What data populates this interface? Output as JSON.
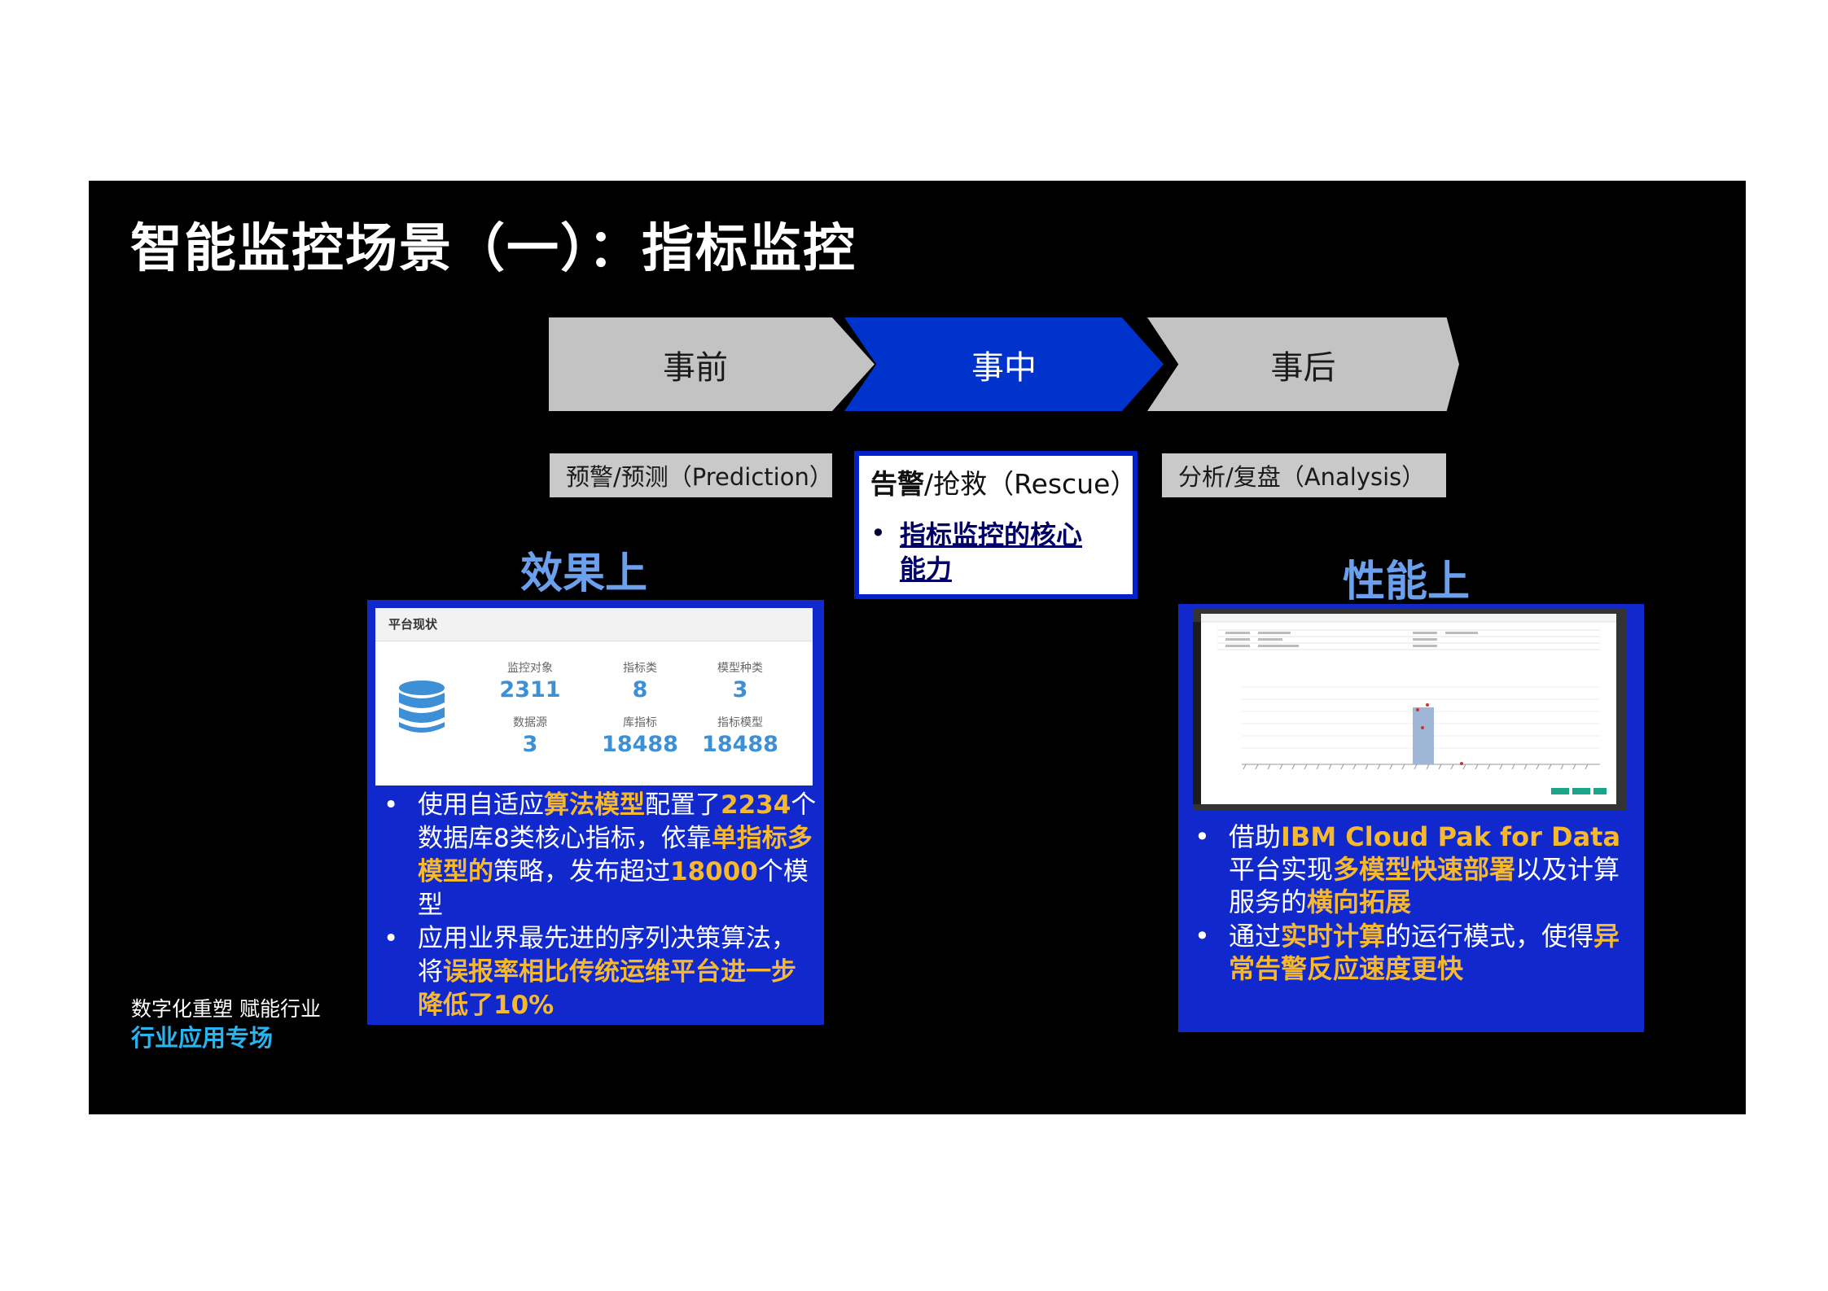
{
  "slide": {
    "title": "智能监控场景（一）：指标监控"
  },
  "process": {
    "stages": [
      {
        "label": "事前"
      },
      {
        "label": "事中"
      },
      {
        "label": "事后"
      }
    ],
    "active_color": "#0033cc",
    "inactive_color": "#c3c3c3"
  },
  "phases": {
    "prediction": "预警/预测（Prediction）",
    "rescue": {
      "title_bold": "告警",
      "title_rest": "/抢救（Rescue）",
      "bullet": "指标监控的核心能力"
    },
    "analysis": "分析/复盘（Analysis）"
  },
  "effect": {
    "heading": "效果上",
    "card": {
      "title": "平台现状",
      "stats": [
        {
          "label": "监控对象",
          "value": "2311"
        },
        {
          "label": "指标类",
          "value": "8"
        },
        {
          "label": "模型种类",
          "value": "3"
        },
        {
          "label": "数据源",
          "value": "3"
        },
        {
          "label": "库指标",
          "value": "18488"
        },
        {
          "label": "指标模型",
          "value": "18488"
        }
      ]
    },
    "bullets": [
      {
        "parts": [
          {
            "t": "使用自适应",
            "hl": false
          },
          {
            "t": "算法模型",
            "hl": true
          },
          {
            "t": "配置了",
            "hl": false
          },
          {
            "t": "2234",
            "hl": true
          },
          {
            "t": "个数据库8类核心指标，依靠",
            "hl": false
          },
          {
            "t": "单指标多模型的",
            "hl": true
          },
          {
            "t": "策略，发布超过",
            "hl": false
          },
          {
            "t": "18000",
            "hl": true
          },
          {
            "t": "个模型",
            "hl": false
          }
        ]
      },
      {
        "parts": [
          {
            "t": "应用业界最先进的序列决策算法，将",
            "hl": false
          },
          {
            "t": "误报率相比传统运维平台进一步降低了10%",
            "hl": true
          }
        ]
      }
    ]
  },
  "performance": {
    "heading": "性能上",
    "bullets": [
      {
        "parts": [
          {
            "t": "借助",
            "hl": false
          },
          {
            "t": "IBM Cloud Pak for Data",
            "hl": true
          },
          {
            "t": "平台实现",
            "hl": false
          },
          {
            "t": "多模型快速部署",
            "hl": true
          },
          {
            "t": "以及计算服务的",
            "hl": false
          },
          {
            "t": "横向拓展",
            "hl": true
          }
        ]
      },
      {
        "parts": [
          {
            "t": "通过",
            "hl": false
          },
          {
            "t": "实时计算",
            "hl": true
          },
          {
            "t": "的运行模式，使得",
            "hl": false
          },
          {
            "t": "异常告警反应速度更快",
            "hl": true
          }
        ]
      }
    ]
  },
  "footer": {
    "line1": "数字化重塑 赋能行业",
    "line2": "行业应用专场"
  },
  "colors": {
    "highlight": "#f5b82e",
    "panel_blue": "#1028cc",
    "heading_blue": "#6aa0ee",
    "footer_cyan": "#28b4f0"
  }
}
